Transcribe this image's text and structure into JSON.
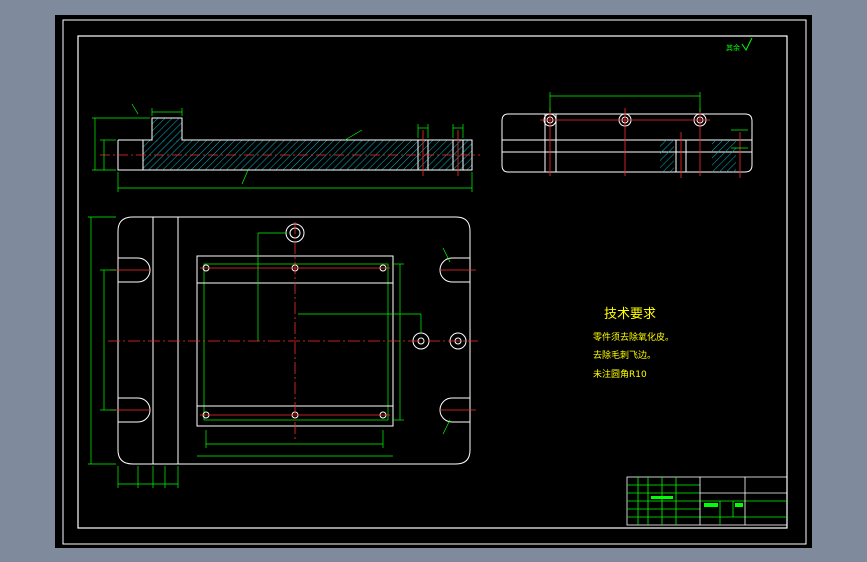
{
  "notes": {
    "title": "技术要求",
    "lines": [
      "零件须去除氧化皮。",
      "去除毛刺飞边。",
      "未注圆角R10"
    ]
  },
  "roughness_symbol": "其余",
  "colors": {
    "background": "#000000",
    "frame": "#ffffff",
    "outline": "#ffffff",
    "centerline": "#ff2a2a",
    "dimension": "#00ff00",
    "hatch": "#00b7c7",
    "title_block": "#00ff00",
    "notes": "#ffff00"
  }
}
